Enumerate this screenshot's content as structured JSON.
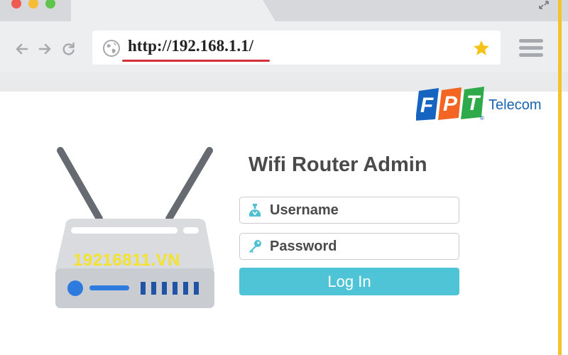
{
  "browser": {
    "url": "http://192.168.1.1/",
    "window_controls": [
      "close",
      "minimize",
      "maximize"
    ],
    "icons": {
      "back": "arrow-left-icon",
      "forward": "arrow-right-icon",
      "reload": "reload-icon",
      "site": "globe-icon",
      "bookmark": "star-icon",
      "menu": "hamburger-menu-icon",
      "resize": "resize-arrows-icon"
    }
  },
  "brand": {
    "logo_letters": [
      "F",
      "P",
      "T"
    ],
    "logo_colors": [
      "#1565c0",
      "#f26522",
      "#2eaa4a"
    ],
    "name": "Telecom",
    "registered_mark": "®"
  },
  "illustration": {
    "watermark": "19216811.VN"
  },
  "login": {
    "title": "Wifi Router Admin",
    "username_placeholder": "Username",
    "password_placeholder": "Password",
    "submit_label": "Log In"
  },
  "colors": {
    "accent_button": "#4fc4d6",
    "url_underline": "#d4303b",
    "star": "#f5c315",
    "right_edge": "#f4c22b"
  }
}
